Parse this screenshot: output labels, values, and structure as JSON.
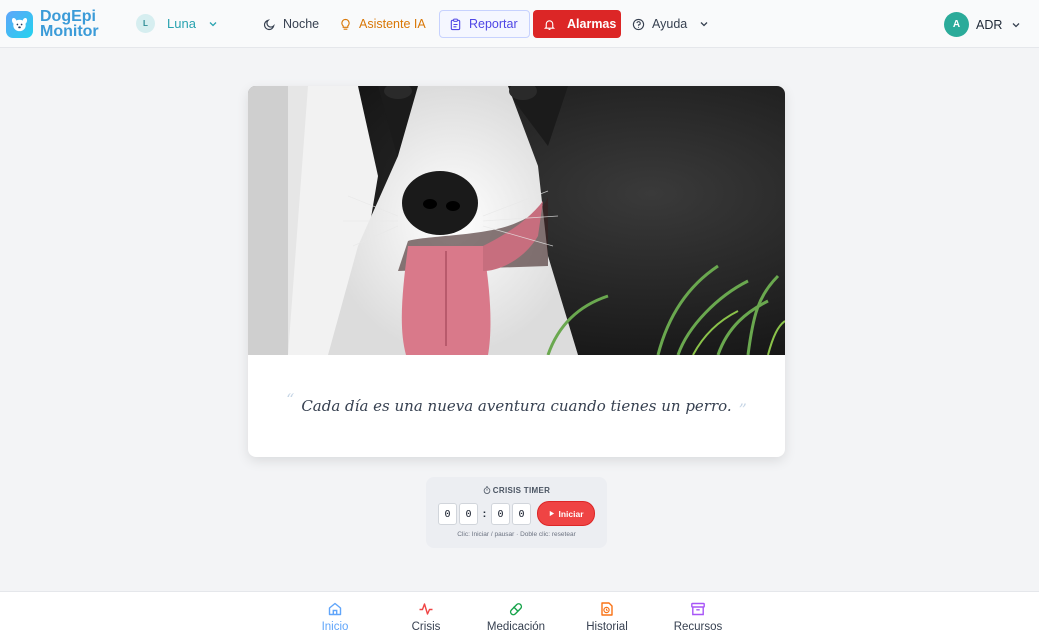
{
  "brand": {
    "line1": "DogEpi",
    "line2": "Monitor"
  },
  "pet": {
    "initial": "L",
    "name": "Luna"
  },
  "nav": {
    "night": "Noche",
    "assistant": "Asistente IA",
    "report": "Reportar",
    "alarms": "Alarmas",
    "help": "Ayuda"
  },
  "user": {
    "initial": "A",
    "name": "ADR"
  },
  "quote": {
    "open_mark": "“",
    "text": "Cada día es una nueva aventura cuando tienes un perro.",
    "close_mark": "”"
  },
  "timer": {
    "title": "CRISIS TIMER",
    "digits": [
      "0",
      "0",
      "0",
      "0"
    ],
    "separator": ":",
    "start_label": "Iniciar",
    "hint": "Clic: Iniciar / pausar · Doble clic: resetear"
  },
  "bottom_nav": [
    {
      "label": "Inicio",
      "icon": "home-icon",
      "active": true,
      "color": "#60a5fa"
    },
    {
      "label": "Crisis",
      "icon": "activity-icon",
      "active": false,
      "color": "#ef4444"
    },
    {
      "label": "Medicación",
      "icon": "pill-icon",
      "active": false,
      "color": "#16a34a"
    },
    {
      "label": "Historial",
      "icon": "history-file-icon",
      "active": false,
      "color": "#f97316"
    },
    {
      "label": "Recursos",
      "icon": "archive-icon",
      "active": false,
      "color": "#a855f7"
    }
  ],
  "colors": {
    "brand": "#3b9bd8",
    "alarm": "#dc2626",
    "report": "#4f46e5",
    "assistant": "#d97706",
    "active_tab": "#60a5fa"
  }
}
